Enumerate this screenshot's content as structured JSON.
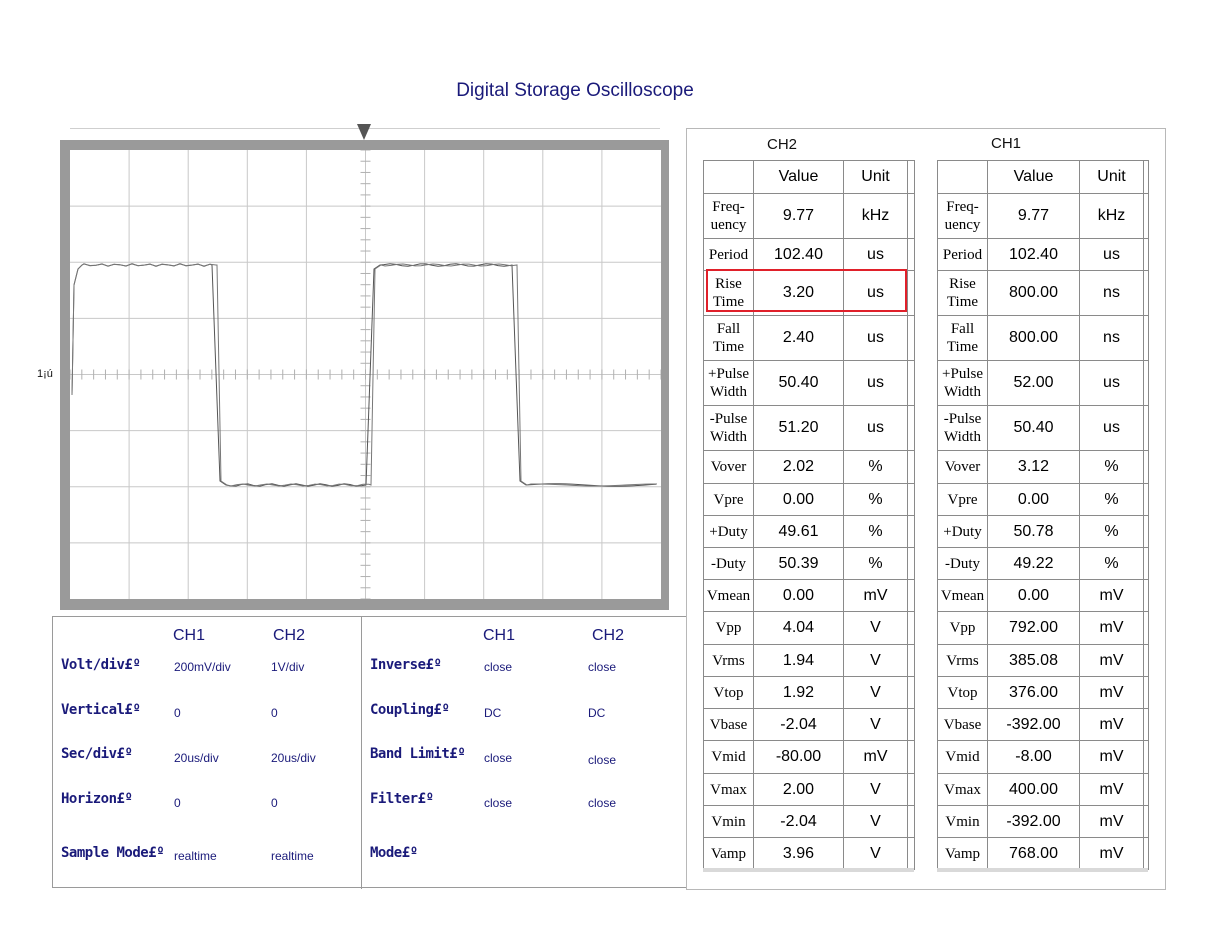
{
  "title": "Digital Storage Oscilloscope",
  "scope": {
    "channel_marker": "1¡ú"
  },
  "settings": {
    "left_headers": [
      "CH1",
      "CH2"
    ],
    "right_headers": [
      "CH1",
      "CH2"
    ],
    "left_rows": [
      {
        "label": "Volt/div£º",
        "ch1": "200mV/div",
        "ch2": "1V/div"
      },
      {
        "label": "Vertical£º",
        "ch1": "0",
        "ch2": "0"
      },
      {
        "label": "Sec/div£º",
        "ch1": "20us/div",
        "ch2": "20us/div"
      },
      {
        "label": "Horizon£º",
        "ch1": "0",
        "ch2": "0"
      },
      {
        "label": "Sample Mode£º",
        "ch1": "realtime",
        "ch2": "realtime"
      }
    ],
    "right_rows": [
      {
        "label": "Inverse£º",
        "ch1": "close",
        "ch2": "close"
      },
      {
        "label": "Coupling£º",
        "ch1": "DC",
        "ch2": "DC"
      },
      {
        "label": "Band Limit£º",
        "ch1": "close",
        "ch2": "close"
      },
      {
        "label": "Filter£º",
        "ch1": "close",
        "ch2": "close"
      },
      {
        "label": "Mode£º",
        "ch1": "",
        "ch2": ""
      }
    ]
  },
  "measurements": {
    "col_value": "Value",
    "col_unit": "Unit",
    "ch2": {
      "title": "CH2",
      "rows": [
        {
          "p1": "Freq-",
          "p2": "uency",
          "value": "9.77",
          "unit": "kHz"
        },
        {
          "p1": "Period",
          "p2": "",
          "value": "102.40",
          "unit": "us"
        },
        {
          "p1": "Rise",
          "p2": "Time",
          "value": "3.20",
          "unit": "us"
        },
        {
          "p1": "Fall",
          "p2": "Time",
          "value": "2.40",
          "unit": "us"
        },
        {
          "p1": "+Pulse",
          "p2": "Width",
          "value": "50.40",
          "unit": "us"
        },
        {
          "p1": "-Pulse",
          "p2": "Width",
          "value": "51.20",
          "unit": "us"
        },
        {
          "p1": "Vover",
          "p2": "",
          "value": "2.02",
          "unit": "%"
        },
        {
          "p1": "Vpre",
          "p2": "",
          "value": "0.00",
          "unit": "%"
        },
        {
          "p1": "+Duty",
          "p2": "",
          "value": "49.61",
          "unit": "%"
        },
        {
          "p1": "-Duty",
          "p2": "",
          "value": "50.39",
          "unit": "%"
        },
        {
          "p1": "Vmean",
          "p2": "",
          "value": "0.00",
          "unit": "mV"
        },
        {
          "p1": "Vpp",
          "p2": "",
          "value": "4.04",
          "unit": "V"
        },
        {
          "p1": "Vrms",
          "p2": "",
          "value": "1.94",
          "unit": "V"
        },
        {
          "p1": "Vtop",
          "p2": "",
          "value": "1.92",
          "unit": "V"
        },
        {
          "p1": "Vbase",
          "p2": "",
          "value": "-2.04",
          "unit": "V"
        },
        {
          "p1": "Vmid",
          "p2": "",
          "value": "-80.00",
          "unit": "mV"
        },
        {
          "p1": "Vmax",
          "p2": "",
          "value": "2.00",
          "unit": "V"
        },
        {
          "p1": "Vmin",
          "p2": "",
          "value": "-2.04",
          "unit": "V"
        },
        {
          "p1": "Vamp",
          "p2": "",
          "value": "3.96",
          "unit": "V"
        }
      ]
    },
    "ch1": {
      "title": "CH1",
      "rows": [
        {
          "p1": "Freq-",
          "p2": "uency",
          "value": "9.77",
          "unit": "kHz"
        },
        {
          "p1": "Period",
          "p2": "",
          "value": "102.40",
          "unit": "us"
        },
        {
          "p1": "Rise",
          "p2": "Time",
          "value": "800.00",
          "unit": "ns"
        },
        {
          "p1": "Fall",
          "p2": "Time",
          "value": "800.00",
          "unit": "ns"
        },
        {
          "p1": "+Pulse",
          "p2": "Width",
          "value": "52.00",
          "unit": "us"
        },
        {
          "p1": "-Pulse",
          "p2": "Width",
          "value": "50.40",
          "unit": "us"
        },
        {
          "p1": "Vover",
          "p2": "",
          "value": "3.12",
          "unit": "%"
        },
        {
          "p1": "Vpre",
          "p2": "",
          "value": "0.00",
          "unit": "%"
        },
        {
          "p1": "+Duty",
          "p2": "",
          "value": "50.78",
          "unit": "%"
        },
        {
          "p1": "-Duty",
          "p2": "",
          "value": "49.22",
          "unit": "%"
        },
        {
          "p1": "Vmean",
          "p2": "",
          "value": "0.00",
          "unit": "mV"
        },
        {
          "p1": "Vpp",
          "p2": "",
          "value": "792.00",
          "unit": "mV"
        },
        {
          "p1": "Vrms",
          "p2": "",
          "value": "385.08",
          "unit": "mV"
        },
        {
          "p1": "Vtop",
          "p2": "",
          "value": "376.00",
          "unit": "mV"
        },
        {
          "p1": "Vbase",
          "p2": "",
          "value": "-392.00",
          "unit": "mV"
        },
        {
          "p1": "Vmid",
          "p2": "",
          "value": "-8.00",
          "unit": "mV"
        },
        {
          "p1": "Vmax",
          "p2": "",
          "value": "400.00",
          "unit": "mV"
        },
        {
          "p1": "Vmin",
          "p2": "",
          "value": "-392.00",
          "unit": "mV"
        },
        {
          "p1": "Vamp",
          "p2": "",
          "value": "768.00",
          "unit": "mV"
        }
      ]
    }
  }
}
